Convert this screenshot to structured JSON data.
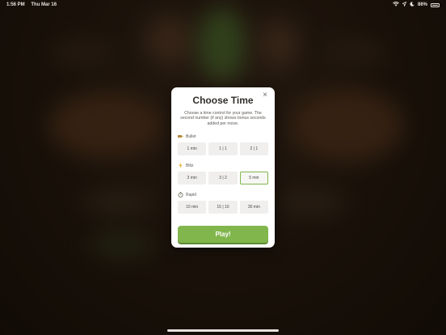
{
  "status_bar": {
    "time": "1:56 PM",
    "date": "Thu Mar 16",
    "battery": "86%"
  },
  "modal": {
    "title": "Choose Time",
    "close_glyph": "×",
    "description": "Choose a time control for your game. The second number (if any) shows bonus seconds added per move.",
    "sections": [
      {
        "label": "Bullet",
        "icon": "bullet-icon",
        "options": [
          "1 min",
          "1 | 1",
          "2 | 1"
        ]
      },
      {
        "label": "Blitz",
        "icon": "lightning-icon",
        "options": [
          "3 min",
          "3 | 2",
          "5 min"
        ]
      },
      {
        "label": "Rapid",
        "icon": "stopwatch-icon",
        "options": [
          "10 min",
          "15 | 10",
          "30 min"
        ]
      }
    ],
    "selected_option": "5 min",
    "play_label": "Play!"
  },
  "colors": {
    "accent": "#81b64c",
    "modal_bg": "#ffffff",
    "option_bg": "#f0efed",
    "title": "#312e2b"
  }
}
